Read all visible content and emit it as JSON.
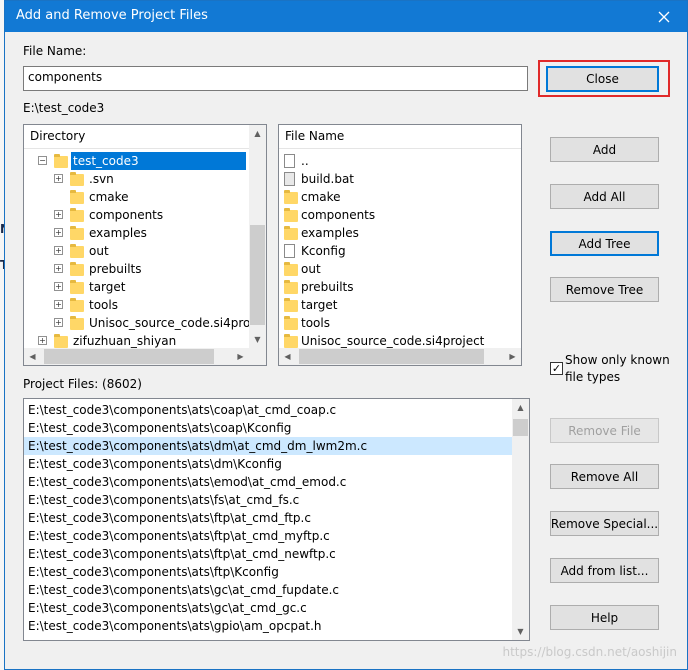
{
  "background_fragments": [
    "N",
    "T-"
  ],
  "dialog": {
    "title": "Add and Remove Project Files",
    "file_name_label": "File Name:",
    "file_name_value": "components",
    "current_path": "E:\\test_code3"
  },
  "directory_panel": {
    "header": "Directory",
    "items": [
      {
        "label": "test_code3",
        "expander": "−",
        "selected": true
      },
      {
        "label": ".svn",
        "expander": "+"
      },
      {
        "label": "cmake",
        "expander": ""
      },
      {
        "label": "components",
        "expander": "+"
      },
      {
        "label": "examples",
        "expander": "+"
      },
      {
        "label": "out",
        "expander": "+"
      },
      {
        "label": "prebuilts",
        "expander": "+"
      },
      {
        "label": "target",
        "expander": "+"
      },
      {
        "label": "tools",
        "expander": "+"
      },
      {
        "label": "Unisoc_source_code.si4proj",
        "expander": "+"
      },
      {
        "label": "zifuzhuan_shiyan",
        "expander": "+"
      }
    ]
  },
  "file_panel": {
    "header": "File Name",
    "items": [
      {
        "label": "..",
        "icon": "file"
      },
      {
        "label": "build.bat",
        "icon": "bat"
      },
      {
        "label": "cmake",
        "icon": "folder"
      },
      {
        "label": "components",
        "icon": "folder"
      },
      {
        "label": "examples",
        "icon": "folder"
      },
      {
        "label": "Kconfig",
        "icon": "file"
      },
      {
        "label": "out",
        "icon": "folder"
      },
      {
        "label": "prebuilts",
        "icon": "folder"
      },
      {
        "label": "target",
        "icon": "folder"
      },
      {
        "label": "tools",
        "icon": "folder"
      },
      {
        "label": "Unisoc_source_code.si4project",
        "icon": "folder"
      }
    ]
  },
  "project_files": {
    "label": "Project Files: (8602)",
    "items": [
      "E:\\test_code3\\components\\ats\\coap\\at_cmd_coap.c",
      "E:\\test_code3\\components\\ats\\coap\\Kconfig",
      "E:\\test_code3\\components\\ats\\dm\\at_cmd_dm_lwm2m.c",
      "E:\\test_code3\\components\\ats\\dm\\Kconfig",
      "E:\\test_code3\\components\\ats\\emod\\at_cmd_emod.c",
      "E:\\test_code3\\components\\ats\\fs\\at_cmd_fs.c",
      "E:\\test_code3\\components\\ats\\ftp\\at_cmd_ftp.c",
      "E:\\test_code3\\components\\ats\\ftp\\at_cmd_myftp.c",
      "E:\\test_code3\\components\\ats\\ftp\\at_cmd_newftp.c",
      "E:\\test_code3\\components\\ats\\ftp\\Kconfig",
      "E:\\test_code3\\components\\ats\\gc\\at_cmd_fupdate.c",
      "E:\\test_code3\\components\\ats\\gc\\at_cmd_gc.c",
      "E:\\test_code3\\components\\ats\\gpio\\am_opcpat.h"
    ],
    "highlighted_index": 2
  },
  "buttons": {
    "close": "Close",
    "add": "Add",
    "add_all": "Add All",
    "add_tree": "Add Tree",
    "remove_tree": "Remove Tree",
    "remove_file": "Remove File",
    "remove_all": "Remove All",
    "remove_special": "Remove Special...",
    "add_from_list": "Add from list...",
    "help": "Help"
  },
  "checkbox": {
    "label": "Show only known file types",
    "checked": true,
    "mark": "✓"
  },
  "watermark": "https://blog.csdn.net/aoshijin",
  "colors": {
    "accent": "#0078d7",
    "title_bar": "#1279d4",
    "highlight_box": "#e02a2a"
  }
}
